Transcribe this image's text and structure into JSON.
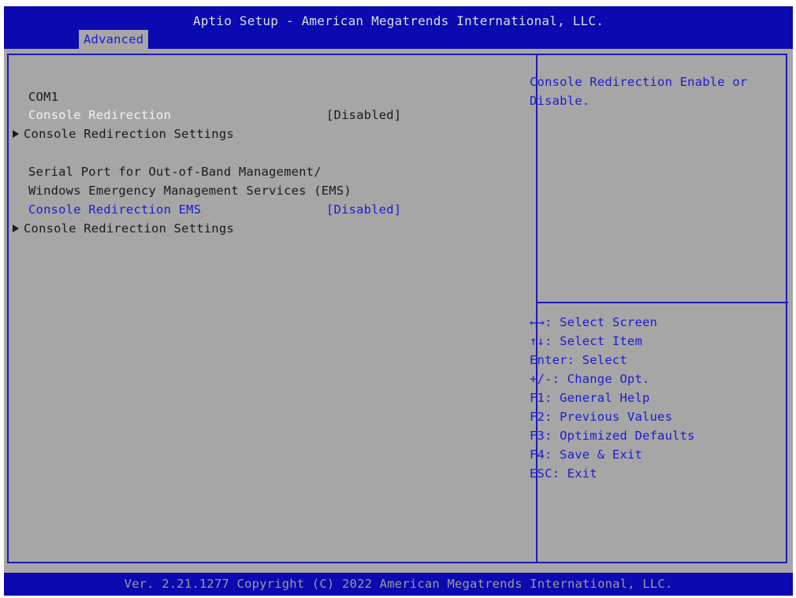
{
  "header": {
    "title": "Aptio Setup - American Megatrends International, LLC.",
    "active_tab": "Advanced"
  },
  "main": {
    "section_com1": "COM1",
    "console_redirection": {
      "label": "Console Redirection",
      "value": "[Disabled]"
    },
    "console_redirection_settings_1": "Console Redirection Settings",
    "serial_port_line1": "Serial Port for Out-of-Band Management/",
    "serial_port_line2": "Windows Emergency Management Services (EMS)",
    "console_redirection_ems": {
      "label": "Console Redirection EMS",
      "value": "[Disabled]"
    },
    "console_redirection_settings_2": "Console Redirection Settings"
  },
  "help": {
    "text": "Console Redirection Enable or\nDisable."
  },
  "keys": [
    "←→: Select Screen",
    "↑↓: Select Item",
    "Enter: Select",
    "+/-: Change Opt.",
    "F1: General Help",
    "F2: Previous Values",
    "F3: Optimized Defaults",
    "F4: Save & Exit",
    "ESC: Exit"
  ],
  "footer": {
    "text": "Ver. 2.21.1277 Copyright (C) 2022 American Megatrends International, LLC."
  },
  "colors": {
    "title_bar": "#0a0ab0",
    "background": "#a6a6a6",
    "highlight_text": "#1c1cd2"
  }
}
